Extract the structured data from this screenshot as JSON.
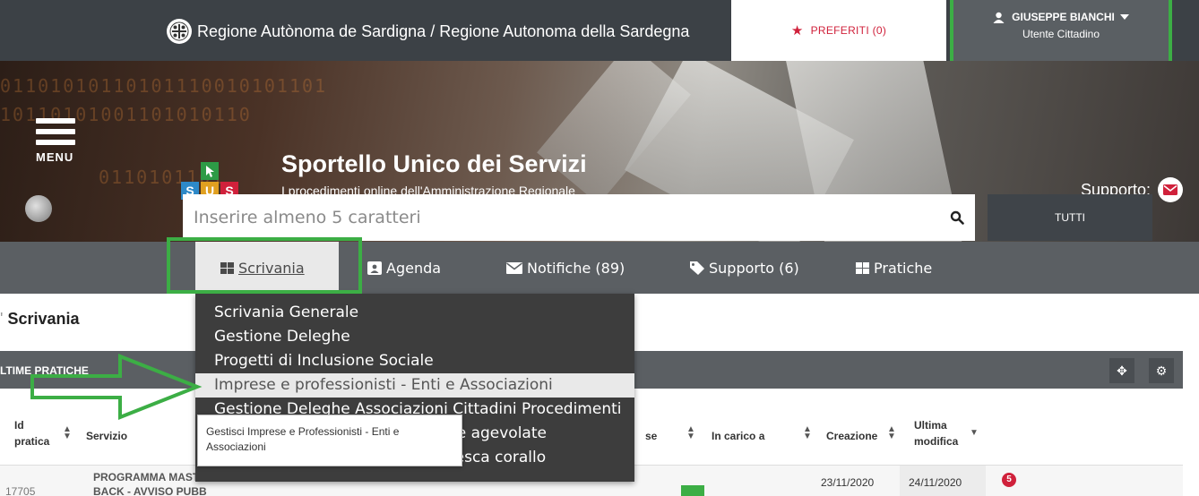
{
  "topbar": {
    "region_title": "Regione Autònoma de Sardigna / Regione Autonoma della Sardegna",
    "favorites_label": "PREFERITI (0)",
    "user_name": "GIUSEPPE BIANCHI",
    "user_role": "Utente Cittadino"
  },
  "hero": {
    "logo_letters": [
      "S",
      "U",
      "S"
    ],
    "title": "Sportello Unico dei Servizi",
    "subtitle": "I procedimenti online dell'Amministrazione Regionale",
    "menu_label": "MENU",
    "support_label": "Supporto:"
  },
  "search": {
    "placeholder": "Inserire almeno 5 caratteri",
    "scope_label": "TUTTI"
  },
  "nav": {
    "items": [
      {
        "label": "Scrivania",
        "icon": "grid-icon"
      },
      {
        "label": "Agenda",
        "icon": "contact-card-icon"
      },
      {
        "label": "Notifiche (89)",
        "icon": "envelope-icon"
      },
      {
        "label": "Supporto (6)",
        "icon": "tag-icon"
      },
      {
        "label": "Pratiche",
        "icon": "grid-icon"
      }
    ]
  },
  "dropdown": {
    "items": [
      "Scrivania Generale",
      "Gestione Deleghe",
      "Progetti di Inclusione Sociale",
      "Imprese e professionisti - Enti e Associazioni",
      "Gestione Deleghe Associazioni Cittadini Procedimenti",
      "ffe agevolate",
      "Pesca corallo"
    ],
    "highlighted_index": 3,
    "tooltip": "Gestisci Imprese e Professionisti - Enti e Associazioni"
  },
  "content": {
    "page_title": "Scrivania",
    "panel_title": "LTIME PRATICHE",
    "columns": {
      "id_line1": "Id",
      "id_line2": "pratica",
      "servizio": "Servizio",
      "stato_partial": "se",
      "in_carico": "In carico a",
      "creazione": "Creazione",
      "ultima_line1": "Ultima",
      "ultima_line2": "modifica"
    },
    "row": {
      "servizio_line1": "PROGRAMMA MAST",
      "servizio_line2": "BACK - AVVISO PUBB",
      "id_partial": "17705",
      "creazione": "23/11/2020",
      "ultima_modifica": "24/11/2020",
      "badge": "5"
    }
  },
  "colors": {
    "annotation_green": "#3cae45",
    "brand_red": "#d0213b",
    "nav_gray": "#5b5f63",
    "topbar_dark": "#3c4146"
  }
}
